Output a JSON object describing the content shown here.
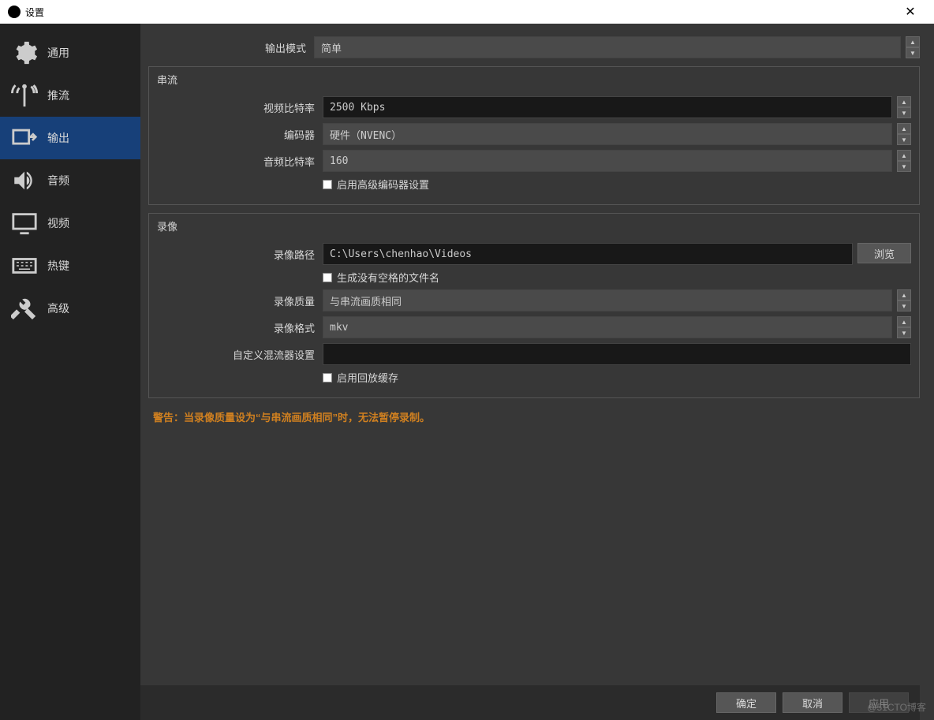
{
  "titlebar": {
    "title": "设置"
  },
  "sidebar": {
    "items": [
      {
        "id": "general",
        "label": "通用"
      },
      {
        "id": "stream",
        "label": "推流"
      },
      {
        "id": "output",
        "label": "输出"
      },
      {
        "id": "audio",
        "label": "音频"
      },
      {
        "id": "video",
        "label": "视频"
      },
      {
        "id": "hotkeys",
        "label": "热键"
      },
      {
        "id": "advanced",
        "label": "高级"
      }
    ]
  },
  "main": {
    "output_mode_label": "输出模式",
    "output_mode_value": "简单",
    "streaming": {
      "legend": "串流",
      "video_bitrate_label": "视频比特率",
      "video_bitrate_value": "2500 Kbps",
      "encoder_label": "编码器",
      "encoder_value": "硬件（NVENC）",
      "audio_bitrate_label": "音频比特率",
      "audio_bitrate_value": "160",
      "advanced_encoder_checkbox": "启用高级编码器设置"
    },
    "recording": {
      "legend": "录像",
      "path_label": "录像路径",
      "path_value": "C:\\Users\\chenhao\\Videos",
      "browse_button": "浏览",
      "nospace_checkbox": "生成没有空格的文件名",
      "quality_label": "录像质量",
      "quality_value": "与串流画质相同",
      "format_label": "录像格式",
      "format_value": "mkv",
      "muxer_label": "自定义混流器设置",
      "muxer_value": "",
      "replay_checkbox": "启用回放缓存"
    },
    "warning": "警告：当录像质量设为“与串流画质相同”时，无法暂停录制。"
  },
  "footer": {
    "ok": "确定",
    "cancel": "取消",
    "apply": "应用"
  },
  "watermark": "@51CTO博客"
}
